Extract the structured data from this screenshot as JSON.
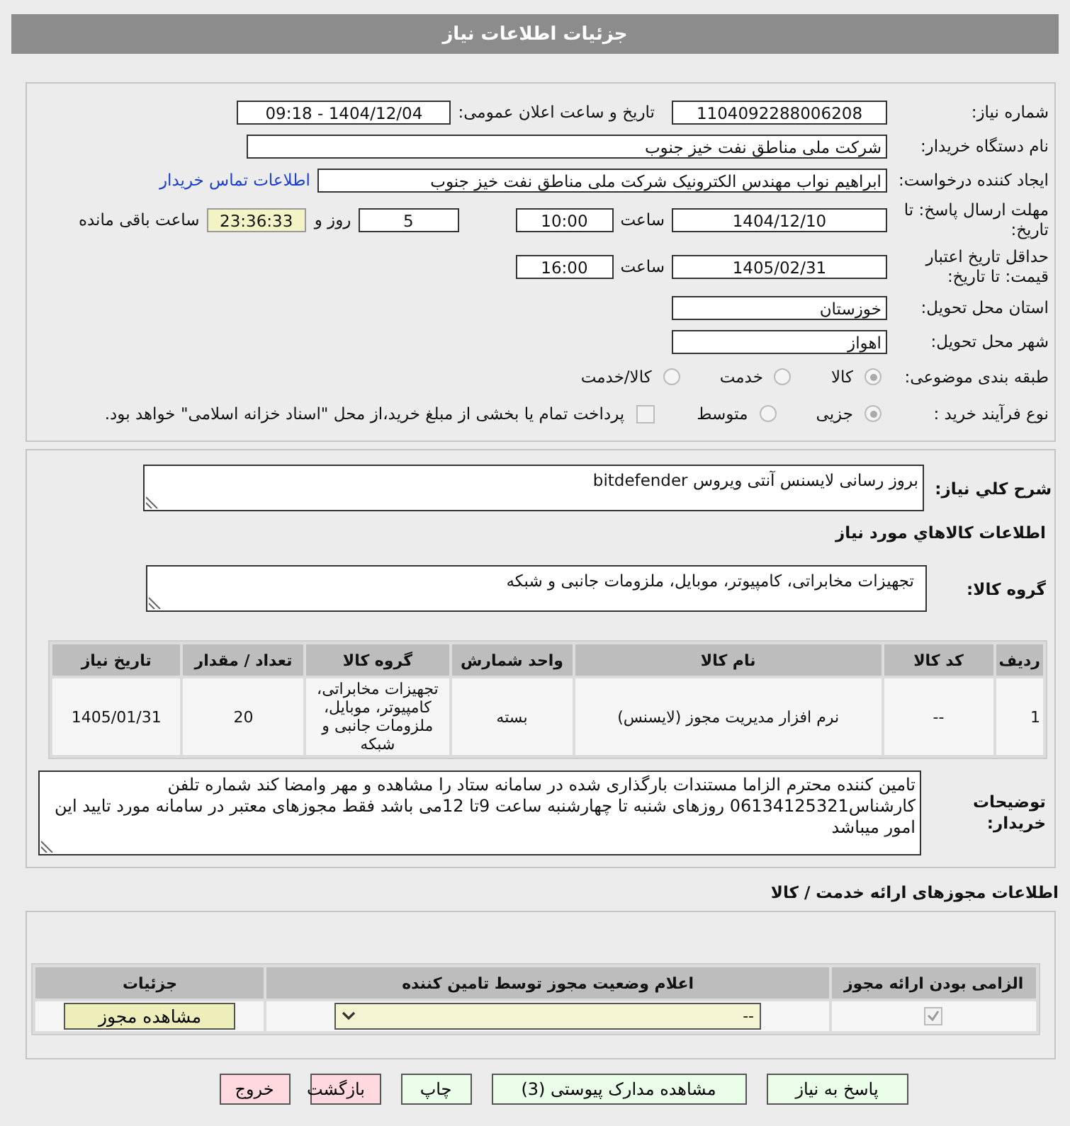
{
  "header": {
    "title": "جزئیات اطلاعات نیاز"
  },
  "need_number": {
    "label": "شماره نیاز:",
    "value": "1104092288006208"
  },
  "announce": {
    "label": "تاریخ و ساعت اعلان عمومی:",
    "value": "1404/12/04 - 09:18"
  },
  "buyer": {
    "label": "نام دستگاه خریدار:",
    "value": "شرکت ملی مناطق نفت خیز جنوب"
  },
  "requester": {
    "label": "ایجاد کننده درخواست:",
    "value": "ابراهیم نواب مهندس الکترونیک شرکت ملی مناطق نفت خیز جنوب",
    "link": "اطلاعات تماس خریدار"
  },
  "deadline": {
    "label": "مهلت ارسال پاسخ: تا تاریخ:",
    "date": "1404/12/10",
    "time_label": "ساعت",
    "time": "10:00",
    "days": "5",
    "days_label": "روز و",
    "remaining": "23:36:33",
    "remaining_label": "ساعت باقی مانده"
  },
  "validity": {
    "label": "حداقل تاریخ اعتبار قیمت: تا تاریخ:",
    "date": "1405/02/31",
    "time_label": "ساعت",
    "time": "16:00"
  },
  "province": {
    "label": "استان محل تحویل:",
    "value": "خوزستان"
  },
  "city": {
    "label": "شهر محل تحویل:",
    "value": "اهواز"
  },
  "category": {
    "label": "طبقه بندی موضوعی:",
    "options": [
      {
        "label": "کالا",
        "selected": true
      },
      {
        "label": "خدمت",
        "selected": false
      },
      {
        "label": "کالا/خدمت",
        "selected": false
      }
    ]
  },
  "purchase_process": {
    "label": "نوع فرآیند خرید :",
    "options": [
      {
        "label": "جزیی",
        "selected": true
      },
      {
        "label": "متوسط",
        "selected": false
      }
    ],
    "payment": {
      "label": "پرداخت تمام یا بخشی از مبلغ خرید،از محل \"اسناد خزانه اسلامی\" خواهد بود.",
      "checked": false
    }
  },
  "description": {
    "label": "شرح کلي نياز:",
    "value": "بروز رسانی لایسنس آنتی ویروس bitdefender"
  },
  "goods_title": "اطلاعات کالاهاي مورد نياز",
  "goods_group": {
    "label": "گروه کالا:",
    "value": "تجهیزات مخابراتی، کامپیوتر، موبایل، ملزومات جانبی و شبکه"
  },
  "goods_table": {
    "columns": [
      "ردیف",
      "کد کالا",
      "نام کالا",
      "واحد شمارش",
      "گروه کالا",
      "تعداد / مقدار",
      "تاریخ نیاز"
    ],
    "rows": [
      [
        "1",
        "--",
        "نرم افزار مدیریت مجوز (لایسنس)",
        "بسته",
        "تجهیزات مخابراتی، کامپیوتر، موبایل، ملزومات جانبی و شبکه",
        "20",
        "1405/01/31"
      ]
    ]
  },
  "buyer_notes": {
    "label": "توضیحات خریدار:",
    "value": "تامین کننده محترم الزاما مستندات بارگذاری شده در سامانه ستاد را مشاهده و مهر وامضا کند شماره تلفن کارشناس06134125321 روزهای شنبه تا چهارشنبه ساعت 9تا 12می باشد فقط مجوزهای معتبر در سامانه مورد تایید این امور میباشد"
  },
  "licenses": {
    "title": "اطلاعات مجوزهای ارائه خدمت / کالا",
    "columns": [
      "الزامی بودن ارائه مجوز",
      "اعلام وضعیت مجوز توسط تامین کننده",
      "جزئیات"
    ],
    "rows": [
      {
        "required": true,
        "status": "--",
        "button": "مشاهده مجوز"
      }
    ]
  },
  "buttons": [
    {
      "label": "پاسخ به نیاز",
      "kind": "normal"
    },
    {
      "label": "مشاهده مدارک پیوستی (3)",
      "kind": "normal"
    },
    {
      "label": "چاپ",
      "kind": "normal"
    },
    {
      "label": "بازگشت",
      "kind": "danger"
    },
    {
      "label": "خروج",
      "kind": "danger"
    }
  ]
}
